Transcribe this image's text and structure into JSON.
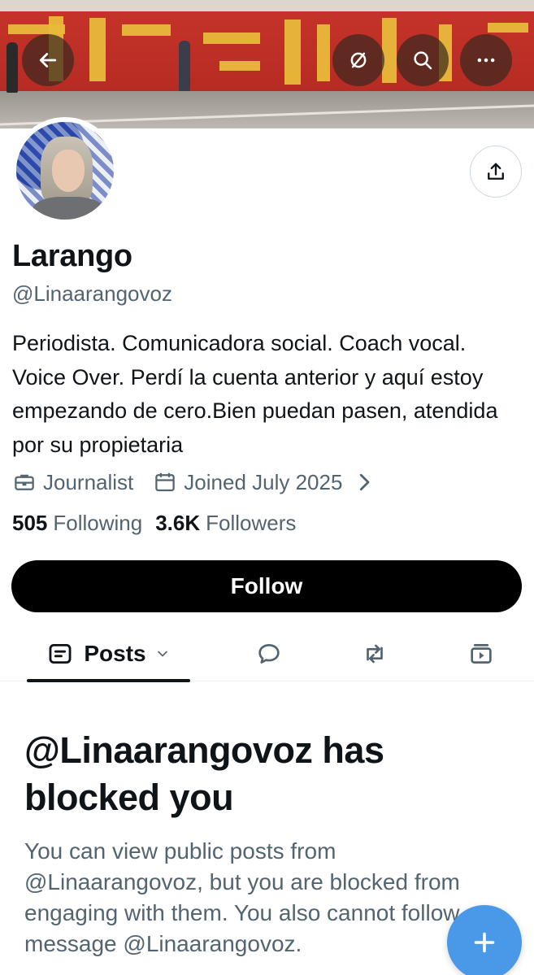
{
  "banner": {
    "back_icon": "arrow-left-icon",
    "hide_icon": "eye-slash-icon",
    "search_icon": "search-icon",
    "more_icon": "more-horizontal-icon"
  },
  "profile": {
    "display_name": "Larango",
    "handle": "@Linaarangovoz",
    "bio": "Periodista. Comunicadora social. Coach vocal. Voice Over. Perdí la cuenta anterior y aquí estoy empezando de cero.Bien puedan pasen, atendida por su propietaria",
    "category": "Journalist",
    "joined": "Joined July 2025",
    "following_count": "505",
    "following_label": "Following",
    "followers_count": "3.6K",
    "followers_label": "Followers"
  },
  "actions": {
    "follow_label": "Follow",
    "share_icon": "share-icon"
  },
  "tabs": {
    "posts_label": "Posts",
    "items": [
      "posts",
      "replies",
      "reposts",
      "media"
    ]
  },
  "blocked": {
    "title": "@Linaarangovoz has blocked you",
    "description": "You can view public posts from @Linaarangovoz, but you are blocked from engaging with them. You also cannot follow or message @Linaarangovoz."
  },
  "fab": {
    "icon": "plus-icon"
  },
  "colors": {
    "text_primary": "#0f1419",
    "text_secondary": "#536471",
    "follow_button_bg": "#000000",
    "fab_bg": "#4a99e9"
  }
}
